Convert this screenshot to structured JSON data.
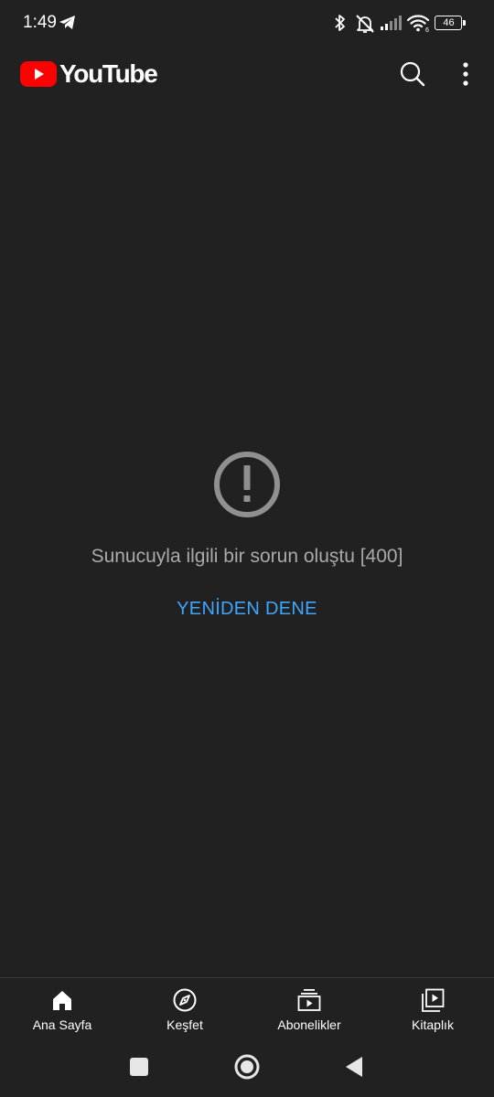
{
  "status_bar": {
    "time": "1:49",
    "battery_level": "46",
    "icons": [
      "telegram-icon",
      "bluetooth-icon",
      "muted-bell-icon",
      "cellular-signal-icon",
      "wifi-icon",
      "battery-icon"
    ]
  },
  "app_bar": {
    "logo_text": "YouTube",
    "icons": [
      "youtube-play-icon",
      "search-icon",
      "more-vertical-icon"
    ]
  },
  "error": {
    "icon": "error-exclamation-icon",
    "message": "Sunucuyla ilgili bir sorun oluştu [400]",
    "retry_label": "YENİDEN DENE"
  },
  "bottom_nav": {
    "items": [
      {
        "label": "Ana Sayfa",
        "icon": "home-icon"
      },
      {
        "label": "Keşfet",
        "icon": "explore-compass-icon"
      },
      {
        "label": "Abonelikler",
        "icon": "subscriptions-icon"
      },
      {
        "label": "Kitaplık",
        "icon": "library-icon"
      }
    ]
  },
  "system_nav": {
    "icons": [
      "recents-square-icon",
      "home-circle-icon",
      "back-triangle-icon"
    ]
  },
  "colors": {
    "background": "#212121",
    "accent_link": "#3ea6ff",
    "youtube_red": "#ff0000",
    "secondary_text": "#aaaaaa",
    "error_icon": "#909090"
  }
}
